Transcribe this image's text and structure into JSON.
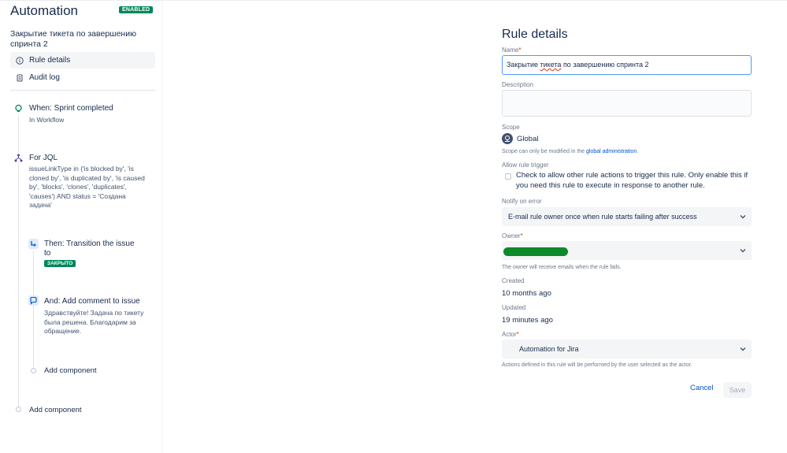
{
  "app": {
    "title": "Automation",
    "status_badge": "ENABLED"
  },
  "rule": {
    "name": "Закрытие тикета по завершению спринта 2"
  },
  "nav": {
    "items": [
      {
        "label": "Rule details",
        "icon": "info-icon",
        "active": true
      },
      {
        "label": "Audit log",
        "icon": "document-icon",
        "active": false
      }
    ]
  },
  "flow": {
    "trigger": {
      "title": "When: Sprint completed",
      "subtitle": "In Workflow",
      "icon": "trigger-icon"
    },
    "condition": {
      "title": "For JQL",
      "lines": [
        "issueLinkType in ('is blocked by', 'is",
        "cloned by', 'is duplicated by', 'is caused",
        "by', 'blocks', 'clones', 'duplicates',",
        "'causes') AND status = 'Создана",
        "задача'"
      ],
      "icon": "branch-icon"
    },
    "transition": {
      "title_line1": "Then: Transition the issue",
      "title_line2": "to",
      "status": "ЗАКРЫТО",
      "icon": "transition-icon"
    },
    "comment": {
      "title": "And: Add comment to issue",
      "lines": [
        "Здравствуйте! Задача по тикету",
        "была решена. Благодарим за",
        "обращение."
      ],
      "icon": "comment-icon"
    },
    "add_component_inner": "Add component",
    "add_component_outer": "Add component"
  },
  "details": {
    "title": "Rule details",
    "name_label": "Name",
    "name_value_prefix": "Закрытие ",
    "name_value_spell": "тикета",
    "name_value_suffix": " по завершению спринта 2",
    "description_label": "Description",
    "scope_label": "Scope",
    "scope_value": "Global",
    "scope_help_prefix": "Scope can only be modified in the ",
    "scope_help_link": "global administration",
    "scope_help_suffix": ".",
    "allow_trigger_label": "Allow rule trigger",
    "allow_trigger_text": "Check to allow other rule actions to trigger this rule. Only enable this if you need this rule to execute in response to another rule.",
    "notify_label": "Notify on error",
    "notify_value": "E-mail rule owner once when rule starts failing after success",
    "owner_label": "Owner",
    "owner_help": "The owner will receive emails when the rule fails.",
    "created_label": "Created",
    "created_value": "10 months ago",
    "updated_label": "Updated",
    "updated_value": "19 minutes ago",
    "actor_label": "Actor",
    "actor_value": "Automation for Jira",
    "actor_help": "Actions defined in this rule will be performed by the user selected as the actor.",
    "required_mark": "*",
    "cancel_label": "Cancel",
    "save_label": "Save"
  },
  "colors": {
    "enabled_badge": "#00875a",
    "link": "#0052cc",
    "focus_border": "#4c9aff",
    "owner_redaction": "#0a8a2a"
  }
}
